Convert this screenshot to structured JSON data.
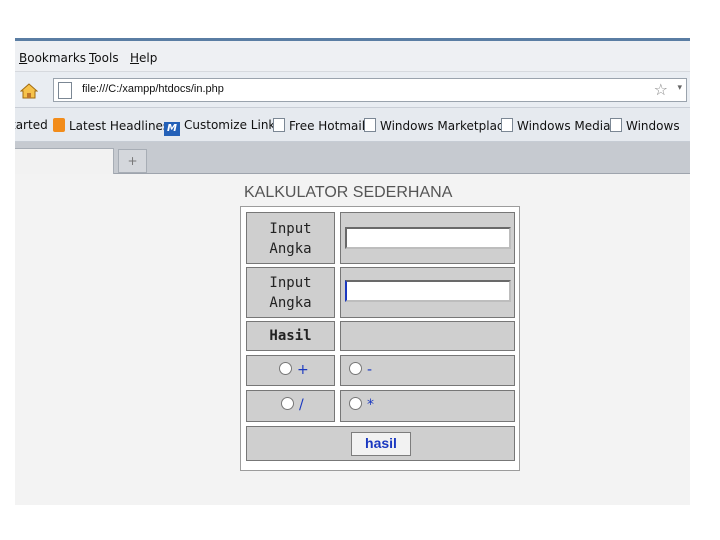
{
  "menubar": {
    "items": [
      {
        "label": "Bookmarks",
        "key": "B",
        "rest": "ookmarks"
      },
      {
        "label": "Tools",
        "key": "T",
        "rest": "ools"
      },
      {
        "label": "Help",
        "key": "H",
        "rest": "elp"
      }
    ]
  },
  "navbar": {
    "url": "file:///C:/xampp/htdocs/in.php",
    "star_icon": "☆",
    "dropdown_icon": "▾"
  },
  "bookmarks": {
    "items": [
      {
        "label": "tarted",
        "icon": "none"
      },
      {
        "label": "Latest Headlines",
        "icon": "rss-icon"
      },
      {
        "label": "Customize Links",
        "icon": "msn-icon"
      },
      {
        "label": "Free Hotmail",
        "icon": "page-icon"
      },
      {
        "label": "Windows Marketplace",
        "icon": "page-icon"
      },
      {
        "label": "Windows Media",
        "icon": "page-icon"
      },
      {
        "label": "Windows",
        "icon": "page-icon"
      }
    ]
  },
  "tabs": {
    "new_tab_symbol": "+"
  },
  "calculator": {
    "title": "KALKULATOR SEDERHANA",
    "input1_label": "Input Angka",
    "input1_label_line1": "Input",
    "input1_label_line2": "Angka",
    "input1_value": "",
    "input2_label_line1": "Input",
    "input2_label_line2": "Angka",
    "input2_value": "",
    "result_label": "Hasil",
    "result_value": "",
    "op_plus": "+",
    "op_minus": "-",
    "op_div": "/",
    "op_mul": "*",
    "submit_label": "hasil"
  }
}
